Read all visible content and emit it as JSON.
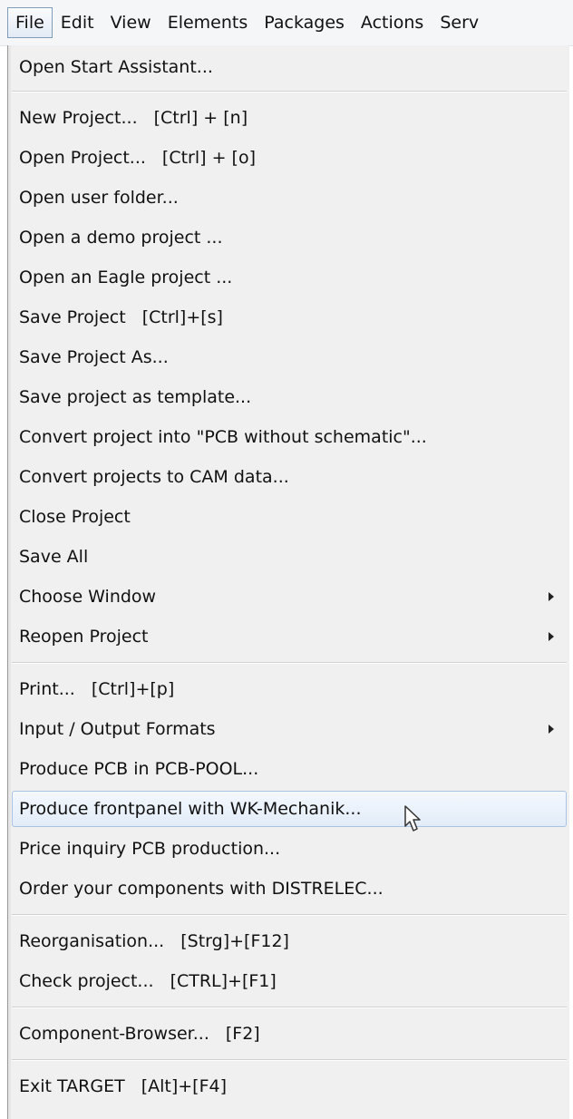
{
  "menubar": {
    "items": [
      "File",
      "Edit",
      "View",
      "Elements",
      "Packages",
      "Actions",
      "Serv"
    ]
  },
  "file_menu": {
    "items": [
      {
        "label": "Open Start Assistant...",
        "shortcut": ""
      },
      {
        "label": "New Project...",
        "shortcut": "[Ctrl] + [n]"
      },
      {
        "label": "Open Project...",
        "shortcut": "[Ctrl] + [o]"
      },
      {
        "label": "Open user folder...",
        "shortcut": ""
      },
      {
        "label": "Open a demo project ...",
        "shortcut": ""
      },
      {
        "label": "Open an Eagle project ...",
        "shortcut": ""
      },
      {
        "label": "Save Project",
        "shortcut": "[Ctrl]+[s]"
      },
      {
        "label": "Save Project As...",
        "shortcut": ""
      },
      {
        "label": "Save project as template...",
        "shortcut": ""
      },
      {
        "label": "Convert project into \"PCB without schematic\"...",
        "shortcut": ""
      },
      {
        "label": "Convert projects to CAM data...",
        "shortcut": ""
      },
      {
        "label": "Close Project",
        "shortcut": ""
      },
      {
        "label": "Save All",
        "shortcut": ""
      },
      {
        "label": "Choose Window",
        "shortcut": "",
        "submenu": true
      },
      {
        "label": "Reopen Project",
        "shortcut": "",
        "submenu": true
      },
      {
        "label": "Print...",
        "shortcut": "[Ctrl]+[p]"
      },
      {
        "label": "Input / Output Formats",
        "shortcut": "",
        "submenu": true
      },
      {
        "label": "Produce PCB in PCB-POOL...",
        "shortcut": ""
      },
      {
        "label": "Produce frontpanel with WK-Mechanik...",
        "shortcut": "",
        "highlighted": true
      },
      {
        "label": "Price inquiry PCB production...",
        "shortcut": ""
      },
      {
        "label": "Order your components with DISTRELEC...",
        "shortcut": ""
      },
      {
        "label": "Reorganisation...",
        "shortcut": "[Strg]+[F12]"
      },
      {
        "label": "Check project...",
        "shortcut": "[CTRL]+[F1]"
      },
      {
        "label": "Component-Browser...",
        "shortcut": "[F2]"
      },
      {
        "label": "Exit TARGET",
        "shortcut": "[Alt]+[F4]"
      }
    ]
  },
  "colors": {
    "menu_bg": "#f0f0f0",
    "highlight_border": "#a9c3e4",
    "active_menubar_border": "#7f9db9"
  },
  "icons": {
    "cursor": "arrow-pointer-icon",
    "submenu": "submenu-arrow-icon"
  }
}
